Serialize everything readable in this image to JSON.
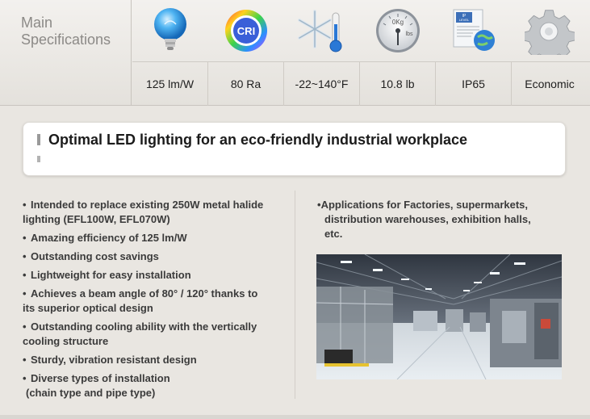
{
  "spec_section": {
    "title_line1": "Main",
    "title_line2": "Specifications",
    "icons": [
      {
        "name": "bulb-icon",
        "label": "LED bulb"
      },
      {
        "name": "cri-icon",
        "text": "CRI"
      },
      {
        "name": "temperature-icon"
      },
      {
        "name": "weight-gauge-icon",
        "text_top": "0Kg",
        "text_side": "lbs"
      },
      {
        "name": "ip-rating-icon",
        "text_line1": "IP",
        "text_line2": "LEVEL"
      },
      {
        "name": "gear-icon"
      }
    ],
    "values": [
      "125 lm/W",
      "80 Ra",
      "-22~140°F",
      "10.8 lb",
      "IP65",
      "Economic"
    ]
  },
  "headline": "Optimal LED lighting for an eco-friendly industrial workplace",
  "features": [
    {
      "line1": "Intended to replace existing 250W metal halide",
      "line2": "lighting (EFL100W, EFL070W)"
    },
    {
      "line1": "Amazing efficiency of 125 lm/W"
    },
    {
      "line1": "Outstanding cost savings"
    },
    {
      "line1": "Lightweight for easy installation"
    },
    {
      "line1": "Achieves a beam angle of 80° / 120° thanks to",
      "line2": "its superior optical design"
    },
    {
      "line1": "Outstanding cooling ability with the vertically",
      "line2": "cooling structure"
    },
    {
      "line1": "Sturdy, vibration resistant design"
    },
    {
      "line1": "Diverse types of installation",
      "line2": "(chain type and pipe type)"
    }
  ],
  "applications": {
    "line1": "Applications for Factories, supermarkets,",
    "line2": "distribution warehouses, exhibition halls,",
    "line3": "etc."
  },
  "colors": {
    "background": "#e9e6e1",
    "card": "#ffffff",
    "bulb_blue": "#2b8fe0",
    "snow_blue": "#5aa6d9"
  }
}
